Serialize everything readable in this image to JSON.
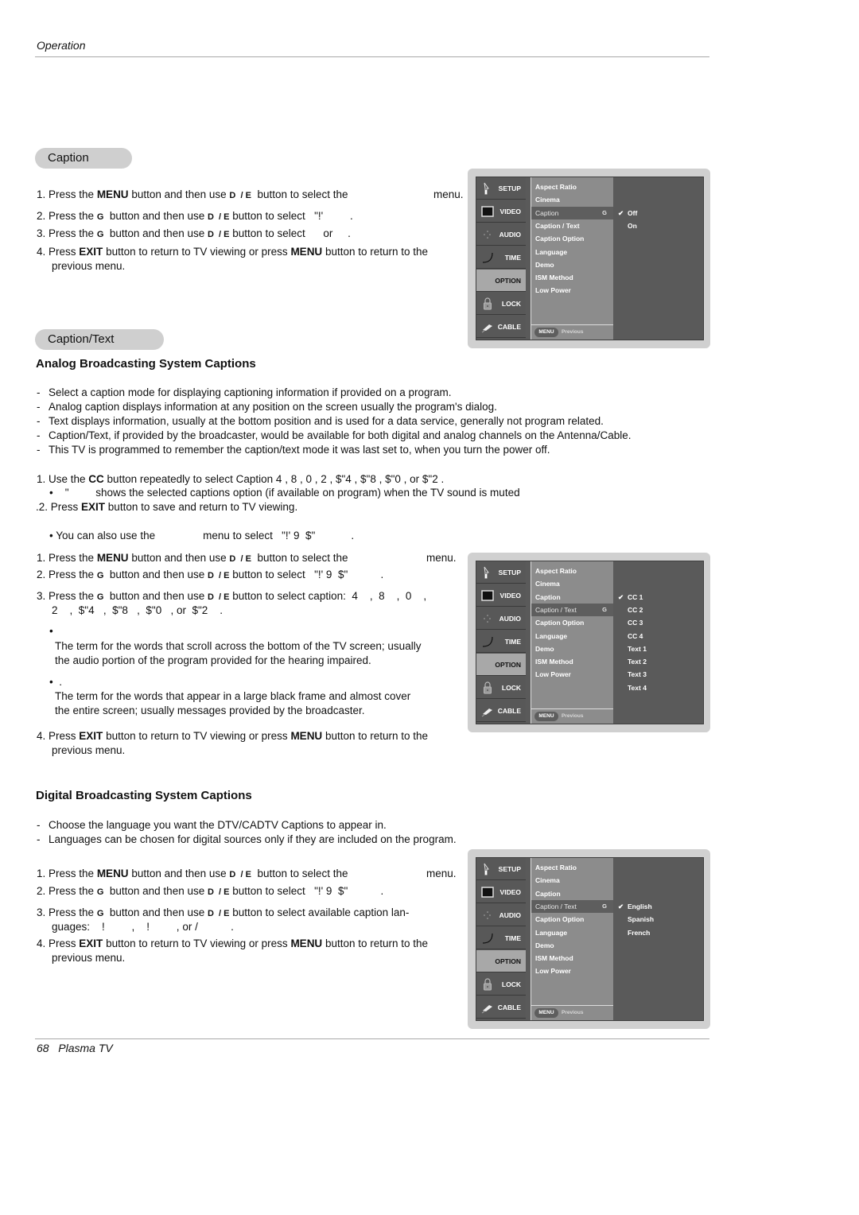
{
  "header": {
    "section": "Operation"
  },
  "footer": {
    "page": "68",
    "title": "Plasma TV",
    "text": "68   Plasma TV"
  },
  "caption_section": {
    "title": "Caption",
    "steps": [
      {
        "num": "1.",
        "pre": "Press the ",
        "bold1": "MENU",
        "mid": " button and then use ",
        "keys": "D  / E",
        "post": "  button to select the",
        "tail": "menu."
      },
      {
        "num": "2.",
        "pre": "Press the ",
        "key1": "G",
        "mid": "  button and then use ",
        "keys": "D  / E",
        "post": " button to select   \"!'         ."
      },
      {
        "num": "3.",
        "pre": "Press the ",
        "key1": "G",
        "mid": "  button and then use ",
        "keys": "D  / E",
        "post": " button to select      or     ."
      },
      {
        "num": "4.",
        "pre": "Press ",
        "bold1": "EXIT",
        "mid": " button to return to TV viewing or press ",
        "bold2": "MENU",
        "post": " button to return to the",
        "line2": "previous menu."
      }
    ]
  },
  "caption_text_section": {
    "title": "Caption/Text",
    "analog": {
      "heading": "Analog Broadcasting System Captions",
      "bullets": [
        "Select a caption mode for displaying captioning information if provided on a program.",
        "Analog caption displays information at any position on the screen usually the program's dialog.",
        "Text displays information, usually at the bottom position and is used for a data service, generally not program related.",
        "Caption/Text, if provided by the broadcaster, would be available for both digital and analog channels on the Antenna/Cable.",
        "This TV is programmed to remember the caption/text mode it was last set to, when you turn the power off."
      ],
      "cc_step1": {
        "pre": "1. Use the ",
        "bold": "CC",
        "post": " button repeatedly to select Caption  4    ,  8    ,  0    ,  2    ,  $\"4   ,  $\"8   ,  $\"0   , or  $\"2    ."
      },
      "cc_note": "•    \"         shows the selected captions option (if available on program) when the TV sound is muted",
      "cc_step2": {
        "pre": ".2. Press ",
        "bold": "EXIT",
        "post": " button to save and return to TV viewing."
      },
      "also_note": "• You can also use the                menu to select   \"!' 9  $\"            .",
      "steps": [
        {
          "num": "1.",
          "pre": "Press the ",
          "bold1": "MENU",
          "mid": " button and then use ",
          "keys": "D  / E",
          "post": "  button to select the",
          "tail": "menu."
        },
        {
          "num": "2.",
          "pre": "Press the ",
          "key1": "G",
          "mid": "  button and then use ",
          "keys": "D  / E",
          "post": " button to select   \"!' 9  $\"           ."
        },
        {
          "num": "3.",
          "pre": "Press the ",
          "key1": "G",
          "mid": "  button and then use ",
          "keys": "D  / E",
          "post": " button to select caption:  4    ,  8    ,  0    ,",
          "line2": "2    ,  $\"4   ,  $\"8   ,  $\"0   , or  $\"2    ."
        },
        {
          "num": "4.",
          "pre": "Press ",
          "bold1": "EXIT",
          "mid": " button to return to TV viewing or press ",
          "bold2": "MENU",
          "post": " button to return to the",
          "line2": "previous menu."
        }
      ],
      "terms": [
        {
          "bullet": "•",
          "desc_line1": "The term for the words that scroll across the bottom of the TV screen; usually",
          "desc_line2": "the audio portion of the program provided for the hearing impaired."
        },
        {
          "bullet": "•  .",
          "desc_line1": "The term for the words that appear in a large black frame and almost cover",
          "desc_line2": "the entire screen; usually messages provided by the broadcaster."
        }
      ]
    },
    "digital": {
      "heading": "Digital Broadcasting System Captions",
      "bullets": [
        "Choose the language you want the DTV/CADTV Captions to appear in.",
        "Languages can be chosen for digital sources only if they are included on the program."
      ],
      "steps": [
        {
          "num": "1.",
          "pre": "Press the ",
          "bold1": "MENU",
          "mid": " button and then use ",
          "keys": "D  / E",
          "post": "  button to select the",
          "tail": "menu."
        },
        {
          "num": "2.",
          "pre": "Press the ",
          "key1": "G",
          "mid": "  button and then use ",
          "keys": "D  / E",
          "post": " button to select   \"!' 9  $\"           ."
        },
        {
          "num": "3.",
          "pre": "Press the ",
          "key1": "G",
          "mid": "  button and then use ",
          "keys": "D  / E",
          "post": " button to select available caption lan-",
          "line2": "guages:    !         ,    !         , or /           ."
        },
        {
          "num": "4.",
          "pre": "Press ",
          "bold1": "EXIT",
          "mid": " button to return to TV viewing or press ",
          "bold2": "MENU",
          "post": " button to return to the",
          "line2": "previous menu."
        }
      ]
    }
  },
  "osd": {
    "nav": [
      {
        "label": "SETUP",
        "icon": "setup-icon"
      },
      {
        "label": "VIDEO",
        "icon": "video-icon"
      },
      {
        "label": "AUDIO",
        "icon": "audio-icon"
      },
      {
        "label": "TIME",
        "icon": "time-icon"
      },
      {
        "label": "OPTION",
        "icon": "option-icon",
        "selected": true
      },
      {
        "label": "LOCK",
        "icon": "lock-icon"
      },
      {
        "label": "CABLE",
        "icon": "cable-icon"
      }
    ],
    "submenu": [
      "Aspect Ratio",
      "Cinema",
      "Caption",
      "Caption / Text",
      "Caption Option",
      "Language",
      "Demo",
      "ISM Method",
      "Low Power"
    ],
    "arrow_glyph": "G",
    "check_glyph": "✔",
    "menu_button": "MENU",
    "menu_previous": "Previous",
    "menus": [
      {
        "selected_sub": 2,
        "options": [
          "Off",
          "On"
        ],
        "checked": 0
      },
      {
        "selected_sub": 3,
        "options": [
          "CC 1",
          "CC 2",
          "CC 3",
          "CC 4",
          "Text 1",
          "Text 2",
          "Text 3",
          "Text 4"
        ],
        "checked": 0
      },
      {
        "selected_sub": 3,
        "options": [
          "English",
          "Spanish",
          "French"
        ],
        "checked": 0
      }
    ]
  },
  "colors": {
    "pill_bg": "#cfcfcf",
    "osd_frame": "#d0d0d0",
    "osd_dark": "#5a5a5a",
    "osd_submenu": "#8c8c8c",
    "osd_selected_nav": "#a8a8a8"
  }
}
